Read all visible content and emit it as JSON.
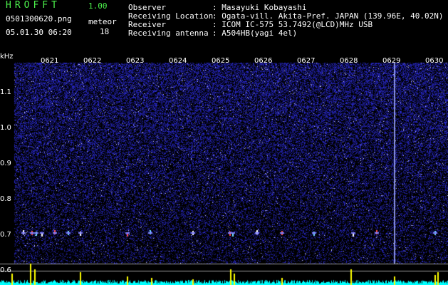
{
  "app": {
    "title": "HROFFT",
    "version": "1.00"
  },
  "file_name": "0501300620.png",
  "datetime": "05.01.30 06:20",
  "meteor": {
    "label": "meteor",
    "count": "18"
  },
  "info": [
    {
      "key": "Observer",
      "value": ": Masayuki Kobayashi"
    },
    {
      "key": "Receiving Location",
      "value": ": Ogata-vill. Akita-Pref. JAPAN (139.96E, 40.02N)"
    },
    {
      "key": "Receiver",
      "value": ": ICOM IC-575 53.7492(@LCD)MHz USB"
    },
    {
      "key": "Receiving antenna",
      "value": ": A504HB(yagi 4el)"
    }
  ],
  "spectrogram": {
    "unit": "kHz",
    "y_ticks": [
      "1.1",
      "1.0",
      "0.9",
      "0.8",
      "0.7",
      "0.6"
    ],
    "x_ticks": [
      "0621",
      "0622",
      "0623",
      "0624",
      "0625",
      "0626",
      "0627",
      "0628",
      "0629",
      "0630"
    ]
  },
  "colors": {
    "title": "#4cf24c",
    "background": "#000000",
    "noise": "#1a1aa6",
    "signal": "#ffff00",
    "baseline": "#00ffff"
  }
}
